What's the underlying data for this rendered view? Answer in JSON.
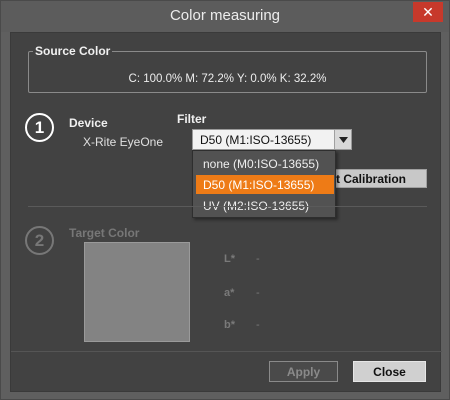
{
  "window": {
    "title": "Color measuring",
    "close_glyph": "✕"
  },
  "source": {
    "label": "Source Color",
    "value": "C: 100.0% M: 72.2% Y: 0.0% K: 32.2%"
  },
  "device_section": {
    "step": "1",
    "device_label": "Device",
    "device_name": "X-Rite EyeOne",
    "filter_label": "Filter",
    "filter_selected": "D50 (M1:ISO-13655)",
    "filter_options": [
      "none (M0:ISO-13655)",
      "D50 (M1:ISO-13655)",
      "UV (M2:ISO-13655)"
    ],
    "calibration_label": "Start Calibration"
  },
  "target_section": {
    "step": "2",
    "label": "Target Color",
    "l_label": "L*",
    "a_label": "a*",
    "b_label": "b*",
    "l_value": "-",
    "a_value": "-",
    "b_value": "-"
  },
  "footer": {
    "apply_label": "Apply",
    "close_label": "Close"
  },
  "colors": {
    "accent": "#ee7b16",
    "close_button": "#c7392b"
  }
}
